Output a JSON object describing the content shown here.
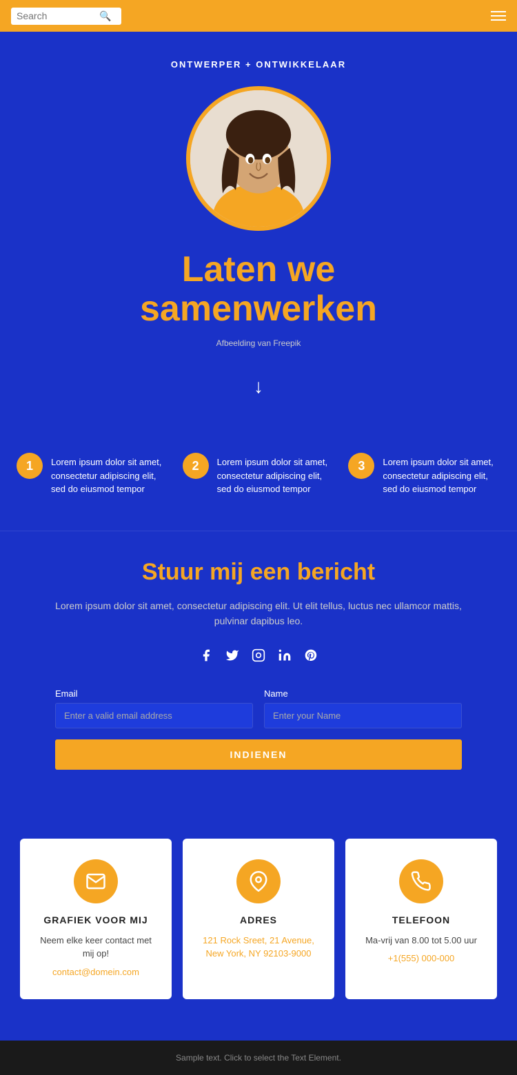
{
  "header": {
    "search_placeholder": "Search",
    "search_icon": "🔍"
  },
  "hero": {
    "subtitle": "ONTWERPER + ONTWIKKELAAR",
    "title_line1": "Laten we",
    "title_line2": "samenwerken",
    "image_credit": "Afbeelding van Freepik"
  },
  "steps": [
    {
      "number": "1",
      "text": "Lorem ipsum dolor sit amet, consectetur adipiscing elit, sed do eiusmod tempor"
    },
    {
      "number": "2",
      "text": "Lorem ipsum dolor sit amet, consectetur adipiscing elit, sed do eiusmod tempor"
    },
    {
      "number": "3",
      "text": "Lorem ipsum dolor sit amet, consectetur adipiscing elit, sed do eiusmod tempor"
    }
  ],
  "contact": {
    "title": "Stuur mij een bericht",
    "description": "Lorem ipsum dolor sit amet, consectetur adipiscing elit. Ut elit tellus, luctus nec ullamcor mattis, pulvinar dapibus leo.",
    "social_icons": [
      "f",
      "t",
      "ig",
      "in",
      "p"
    ],
    "email_label": "Email",
    "email_placeholder": "Enter a valid email address",
    "name_label": "Name",
    "name_placeholder": "Enter your Name",
    "submit_label": "INDIENEN"
  },
  "cards": [
    {
      "icon": "✉",
      "title": "GRAFIEK VOOR MIJ",
      "text": "Neem elke keer contact met mij op!",
      "link": "contact@domein.com",
      "link_type": "email"
    },
    {
      "icon": "📍",
      "title": "ADRES",
      "address_line1": "121 Rock Sreet, 21 Avenue,",
      "address_line2": "New York, NY 92103-9000",
      "link_type": "address"
    },
    {
      "icon": "📞",
      "title": "TELEFOON",
      "text": "Ma-vrij van 8.00 tot 5.00 uur",
      "link": "+1(555) 000-000",
      "link_type": "phone"
    }
  ],
  "footer": {
    "text": "Sample text. Click to select the Text Element."
  }
}
